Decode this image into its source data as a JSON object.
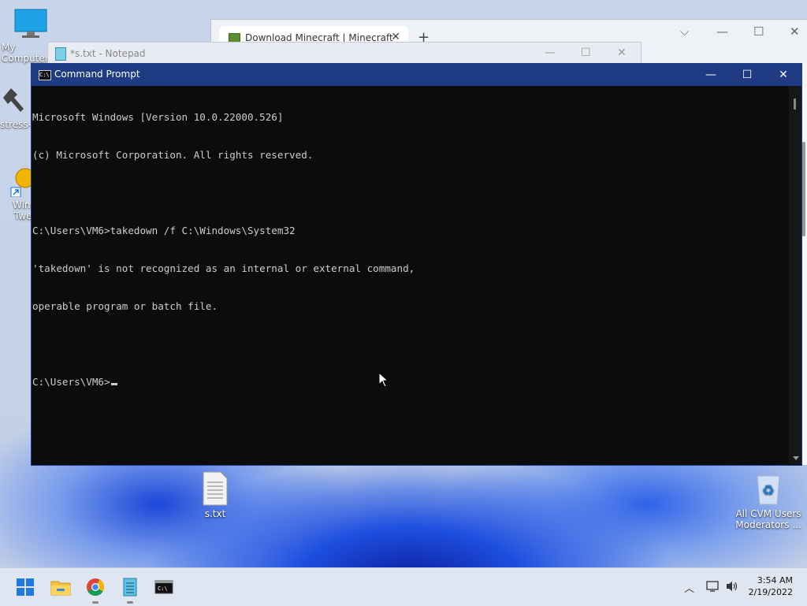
{
  "desktop": {
    "icons": [
      {
        "label": "My Computer"
      },
      {
        "label": "stress-"
      },
      {
        "label": "Win"
      },
      {
        "label": "Twe"
      },
      {
        "label": "s.txt"
      },
      {
        "label": "All CVM Users"
      },
      {
        "label": "Moderators ..."
      }
    ]
  },
  "browser": {
    "tab_title": "Download Minecraft | Minecraft",
    "tab_close": "✕",
    "new_tab": "+",
    "ctl_dropdown": "⌵",
    "ctl_min": "—",
    "ctl_max": "☐",
    "ctl_close": "✕"
  },
  "notepad": {
    "title": "*s.txt - Notepad",
    "ctl_min": "—",
    "ctl_max": "☐",
    "ctl_close": "✕"
  },
  "cmd": {
    "title": "Command Prompt",
    "icon_text": "C:\\",
    "ctl_min": "—",
    "ctl_max": "☐",
    "ctl_close": "✕",
    "lines": [
      "Microsoft Windows [Version 10.0.22000.526]",
      "(c) Microsoft Corporation. All rights reserved.",
      "",
      "C:\\Users\\VM6>takedown /f C:\\Windows\\System32",
      "'takedown' is not recognized as an internal or external command,",
      "operable program or batch file.",
      "",
      "C:\\Users\\VM6>"
    ]
  },
  "taskbar": {
    "clock_time": "3:54 AM",
    "clock_date": "2/19/2022",
    "tray_chevron": "︿"
  },
  "colors": {
    "cmd_titlebar": "#1f3b84",
    "console_bg": "#0c0c0c",
    "console_fg": "#cccccc"
  }
}
